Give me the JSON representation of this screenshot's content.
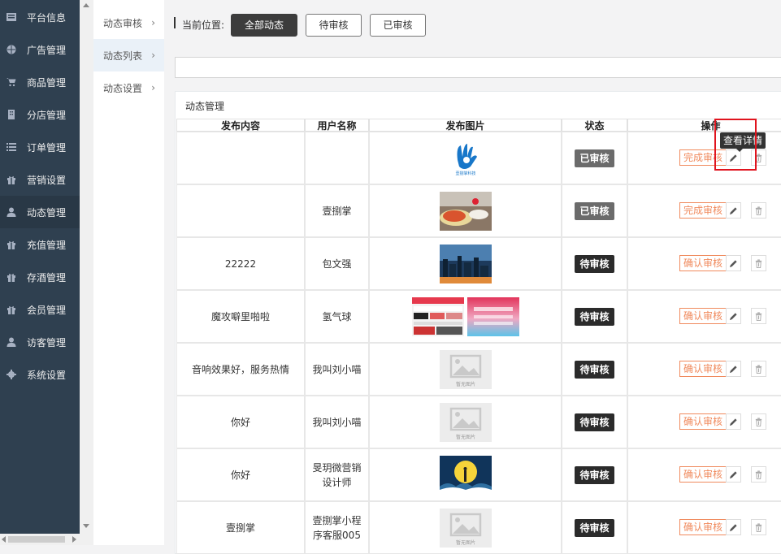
{
  "leftnav": {
    "items": [
      {
        "label": "平台信息",
        "icon": "newspaper-icon"
      },
      {
        "label": "广告管理",
        "icon": "globe-icon"
      },
      {
        "label": "商品管理",
        "icon": "cart-icon"
      },
      {
        "label": "分店管理",
        "icon": "building-icon"
      },
      {
        "label": "订单管理",
        "icon": "list-icon"
      },
      {
        "label": "营销设置",
        "icon": "gift-icon"
      },
      {
        "label": "动态管理",
        "icon": "user-icon",
        "active": true
      },
      {
        "label": "充值管理",
        "icon": "gift-icon"
      },
      {
        "label": "存酒管理",
        "icon": "gift-icon"
      },
      {
        "label": "会员管理",
        "icon": "gift-icon"
      },
      {
        "label": "访客管理",
        "icon": "user-icon"
      },
      {
        "label": "系统设置",
        "icon": "gear-icon"
      }
    ]
  },
  "subnav": {
    "items": [
      {
        "label": "动态审核"
      },
      {
        "label": "动态列表",
        "active": true
      },
      {
        "label": "动态设置"
      }
    ]
  },
  "breadcrumb": {
    "label": "当前位置:"
  },
  "filters": {
    "all": "全部动态",
    "pending": "待审核",
    "reviewed": "已审核"
  },
  "panel": {
    "title": "动态管理"
  },
  "table": {
    "headers": [
      "发布内容",
      "用户名称",
      "发布图片",
      "状态",
      "操作"
    ],
    "rows": [
      {
        "content": "",
        "user": "",
        "images": [
          "logo"
        ],
        "status": "已审核",
        "status_kind": "done",
        "action": "完成审核"
      },
      {
        "content": "",
        "user": "壹捌掌",
        "images": [
          "food"
        ],
        "status": "已审核",
        "status_kind": "done",
        "action": "完成审核"
      },
      {
        "content": "22222",
        "user": "包文强",
        "images": [
          "city"
        ],
        "status": "待审核",
        "status_kind": "pend",
        "action": "确认审核"
      },
      {
        "content": "魔攻噼里啪啦",
        "user": "氢气球",
        "images": [
          "screen1",
          "screen2"
        ],
        "status": "待审核",
        "status_kind": "pend",
        "action": "确认审核"
      },
      {
        "content": "音响效果好，服务热情",
        "user": "我叫刘小喵",
        "images": [
          "placeholder"
        ],
        "status": "待审核",
        "status_kind": "pend",
        "action": "确认审核"
      },
      {
        "content": "你好",
        "user": "我叫刘小喵",
        "images": [
          "placeholder"
        ],
        "status": "待审核",
        "status_kind": "pend",
        "action": "确认审核"
      },
      {
        "content": "你好",
        "user": "旻玥微营销设计师",
        "images": [
          "moon"
        ],
        "status": "待审核",
        "status_kind": "pend",
        "action": "确认审核"
      },
      {
        "content": "壹捌掌",
        "user": "壹捌掌小程序客服005",
        "images": [
          "placeholder"
        ],
        "status": "待审核",
        "status_kind": "pend",
        "action": "确认审核"
      }
    ],
    "placeholder_caption": "暂无图片",
    "logo_caption": "壹捌掌科技"
  },
  "tooltip": {
    "text": "查看详情"
  },
  "colors": {
    "sidebar": "#2f4050",
    "accent": "#f08a5d",
    "highlight": "#e0141e"
  }
}
